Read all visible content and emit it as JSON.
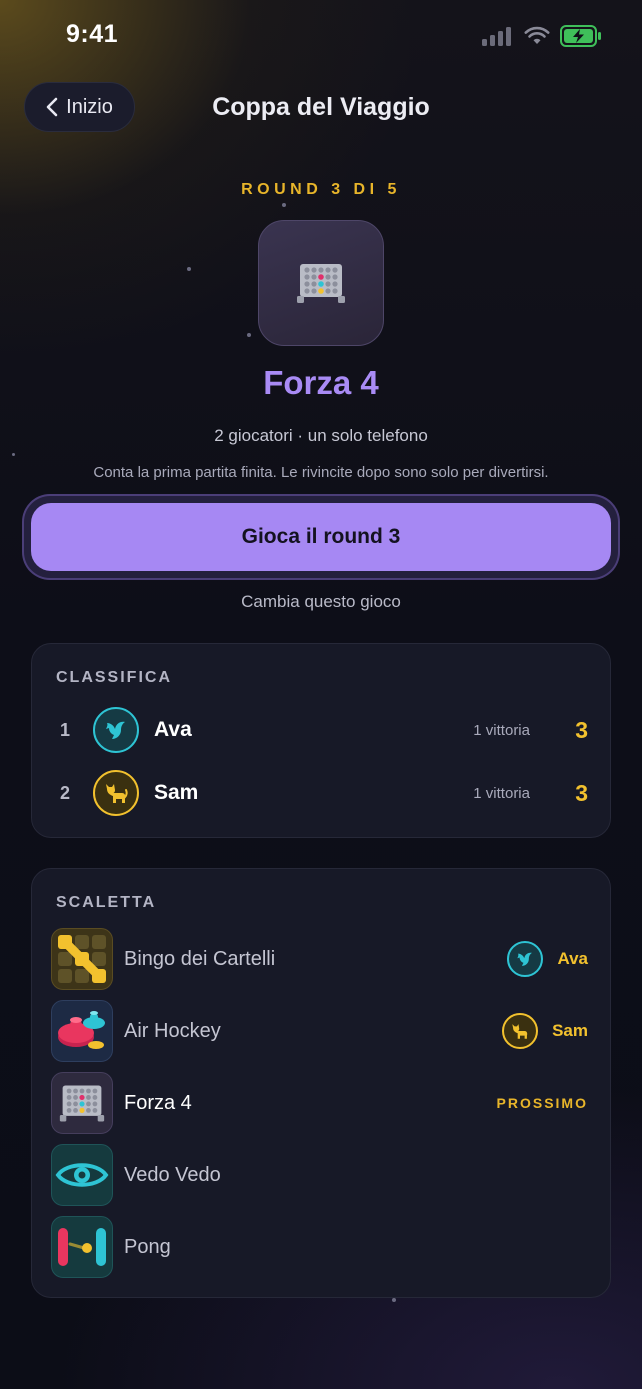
{
  "status_bar": {
    "time": "9:41"
  },
  "header": {
    "back_label": "Inizio",
    "title": "Coppa del Viaggio"
  },
  "hero": {
    "round_label": "ROUND 3 DI 5",
    "game_title": "Forza 4",
    "subtitle": "2 giocatori · un solo telefono",
    "note": "Conta la prima partita finita. Le rivincite dopo sono solo per divertirsi.",
    "play_button": "Gioca il round 3",
    "change_link": "Cambia questo gioco"
  },
  "leaderboard": {
    "title": "CLASSIFICA",
    "rows": [
      {
        "rank": "1",
        "name": "Ava",
        "wins": "1 vittoria",
        "score": "3",
        "avatar": "bird-icon"
      },
      {
        "rank": "2",
        "name": "Sam",
        "wins": "1 vittoria",
        "score": "3",
        "avatar": "cat-icon"
      }
    ]
  },
  "schedule": {
    "title": "SCALETTA",
    "items": [
      {
        "name": "Bingo dei Cartelli",
        "winner": "Ava",
        "icon": "bingo-grid-icon"
      },
      {
        "name": "Air Hockey",
        "winner": "Sam",
        "icon": "air-hockey-icon"
      },
      {
        "name": "Forza 4",
        "status": "PROSSIMO",
        "icon": "connect-four-icon"
      },
      {
        "name": "Vedo Vedo",
        "icon": "eye-icon"
      },
      {
        "name": "Pong",
        "icon": "pong-icon"
      }
    ]
  },
  "colors": {
    "accent_purple": "#a688f3",
    "gold": "#f2c12e",
    "ava_teal": "#2ec4d4",
    "sam_yellow": "#f2c12e"
  }
}
